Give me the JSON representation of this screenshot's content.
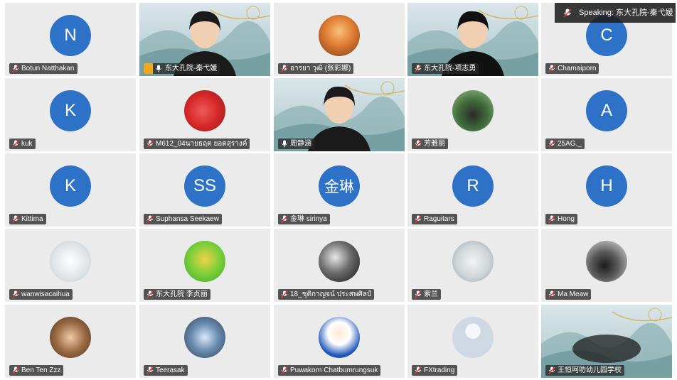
{
  "speaking": {
    "label": "Speaking:",
    "name": "东大孔院-秦弋媛"
  },
  "colors": {
    "avatar_blue": "#2d72c6",
    "active_border": "#3bd17b",
    "host_badge": "#f0a81e"
  },
  "tiles": [
    {
      "name": "Botun Natthakan",
      "type": "letter",
      "letter": "N",
      "mic": "muted"
    },
    {
      "name": "东大孔院-秦弋媛",
      "type": "video",
      "mic": "on",
      "host": true,
      "active": true
    },
    {
      "name": "อารยา วุฒิ (张彩娜)",
      "type": "photo",
      "photo": "orange",
      "mic": "muted"
    },
    {
      "name": "东大孔院-项志勇",
      "type": "video",
      "mic": "muted"
    },
    {
      "name": "Chamaiporn",
      "type": "letter",
      "letter": "C",
      "mic": "muted"
    },
    {
      "name": "kuk",
      "type": "letter",
      "letter": "K",
      "mic": "muted"
    },
    {
      "name": "M612_04นายธฤต ยอดสุรางค์",
      "type": "photo",
      "photo": "red",
      "mic": "muted"
    },
    {
      "name": "周静涵",
      "type": "video",
      "mic": "on"
    },
    {
      "name": "芳雅丽",
      "type": "photo",
      "photo": "green",
      "mic": "muted"
    },
    {
      "name": "25AG._",
      "type": "letter",
      "letter": "A",
      "mic": "muted"
    },
    {
      "name": "Kittima",
      "type": "letter",
      "letter": "K",
      "mic": "muted"
    },
    {
      "name": "Suphansa Seekaew",
      "type": "letter",
      "letter": "SS",
      "mic": "muted"
    },
    {
      "name": "金琳 sirinya",
      "type": "letter",
      "letter": "金琳",
      "mic": "muted",
      "cjk": true
    },
    {
      "name": "Raguitars",
      "type": "letter",
      "letter": "R",
      "mic": "muted"
    },
    {
      "name": "Hong",
      "type": "letter",
      "letter": "H",
      "mic": "muted"
    },
    {
      "name": "wanwisacaihua",
      "type": "photo",
      "photo": "white",
      "mic": "muted"
    },
    {
      "name": "东大孔院 李贞丽",
      "type": "photo",
      "photo": "lime",
      "mic": "muted"
    },
    {
      "name": "18_ชุติกาญจน์ ประสพศิลป์",
      "type": "photo",
      "photo": "dark",
      "mic": "muted"
    },
    {
      "name": "紫兰",
      "type": "photo",
      "photo": "gray",
      "mic": "muted"
    },
    {
      "name": "Ma Meaw",
      "type": "photo",
      "photo": "cat",
      "mic": "muted"
    },
    {
      "name": "Ben Ten Zzz",
      "type": "photo",
      "photo": "brown",
      "mic": "muted"
    },
    {
      "name": "Teerasak",
      "type": "photo",
      "photo": "blue",
      "mic": "muted"
    },
    {
      "name": "Puwakorn Chatbumrungsuk",
      "type": "photo",
      "photo": "suit",
      "mic": "muted"
    },
    {
      "name": "FXtrading",
      "type": "photo",
      "photo": "default",
      "mic": "muted"
    },
    {
      "name": "王恒呵叻幼儿园学校",
      "type": "video",
      "mic": "muted",
      "ink": true
    }
  ]
}
